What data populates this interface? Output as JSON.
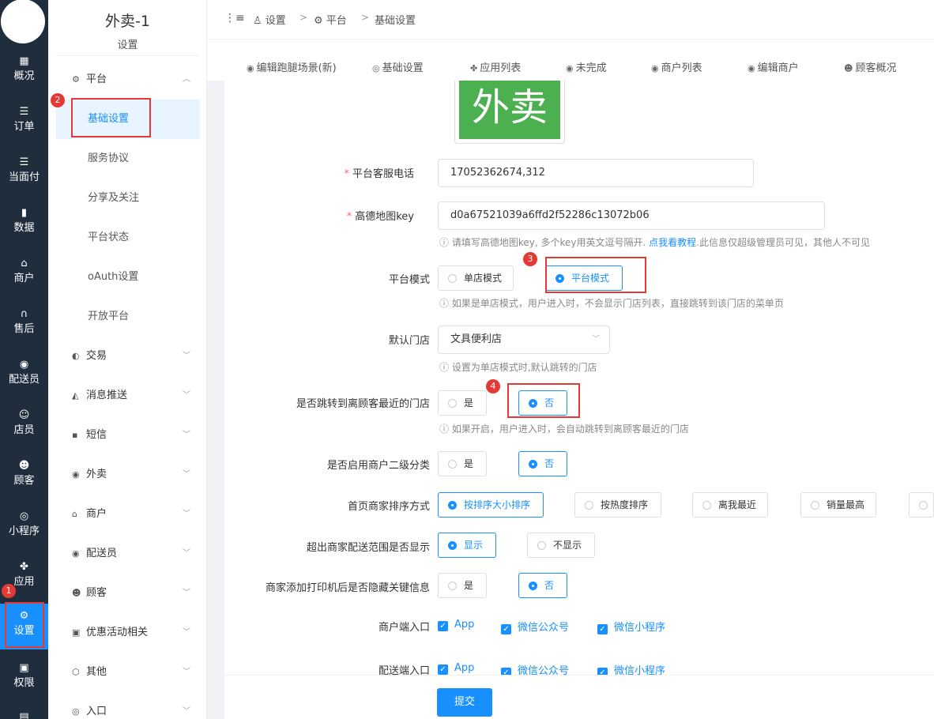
{
  "leftnav": {
    "items": [
      {
        "label": "概况",
        "icon": "grid-icon"
      },
      {
        "label": "订单",
        "icon": "list-icon"
      },
      {
        "label": "当面付",
        "icon": "list-icon"
      },
      {
        "label": "数据",
        "icon": "bar-chart-icon"
      },
      {
        "label": "商户",
        "icon": "store-icon"
      },
      {
        "label": "售后",
        "icon": "headset-icon"
      },
      {
        "label": "配送员",
        "icon": "scooter-icon"
      },
      {
        "label": "店员",
        "icon": "users-icon"
      },
      {
        "label": "顾客",
        "icon": "user-circle-icon"
      },
      {
        "label": "小程序",
        "icon": "wechat-icon"
      },
      {
        "label": "应用",
        "icon": "apps-icon"
      },
      {
        "label": "设置",
        "icon": "user-settings-icon"
      },
      {
        "label": "权限",
        "icon": "lock-icon"
      }
    ]
  },
  "annotations": {
    "n1": "1",
    "n2": "2",
    "n3": "3",
    "n4": "4"
  },
  "subnav": {
    "title": "外卖-1",
    "subtitle": "设置",
    "platform_group": "平台",
    "platform_items": [
      "基础设置",
      "服务协议",
      "分享及关注",
      "平台状态",
      "oAuth设置",
      "开放平台"
    ],
    "groups": [
      "交易",
      "消息推送",
      "短信",
      "外卖",
      "商户",
      "配送员",
      "顾客",
      "优惠活动相关",
      "其他",
      "入口"
    ]
  },
  "breadcrumb": {
    "items": [
      "设置",
      "平台",
      "基础设置"
    ],
    "separator": ">"
  },
  "tabs": [
    "编辑跑腿场景(新)",
    "基础设置",
    "应用列表",
    "未完成",
    "商户列表",
    "编辑商户",
    "顾客概况"
  ],
  "logo": {
    "text": "外卖"
  },
  "form": {
    "phone": {
      "label": "平台客服电话",
      "value": "17052362674,312"
    },
    "amap": {
      "label": "高德地图key",
      "value": "d0a67521039a6ffd2f52286c13072b06",
      "hint_pre": "请填写高德地图key, 多个key用英文逗号隔开. ",
      "hint_link": "点我看教程",
      "hint_post": ".此信息仅超级管理员可见，其他人不可见"
    },
    "mode": {
      "label": "平台模式",
      "options": [
        "单店模式",
        "平台模式"
      ],
      "selected": "平台模式",
      "hint": "如果是单店模式，用户进入时，不会显示门店列表，直接跳转到该门店的菜单页"
    },
    "default_store": {
      "label": "默认门店",
      "value": "文具便利店",
      "hint": "设置为单店模式时,默认跳转的门店"
    },
    "nearest": {
      "label": "是否跳转到离顾客最近的门店",
      "options": [
        "是",
        "否"
      ],
      "selected": "否",
      "hint": "如果开启，用户进入时，会自动跳转到离顾客最近的门店"
    },
    "subcat": {
      "label": "是否启用商户二级分类",
      "options": [
        "是",
        "否"
      ],
      "selected": "否"
    },
    "sort": {
      "label": "首页商家排序方式",
      "options": [
        "按排序大小排序",
        "按热度排序",
        "离我最近",
        "销量最高"
      ],
      "selected": "按排序大小排序"
    },
    "out_range": {
      "label": "超出商家配送范围是否显示",
      "options": [
        "显示",
        "不显示"
      ],
      "selected": "显示"
    },
    "printer": {
      "label": "商家添加打印机后是否隐藏关键信息",
      "options": [
        "是",
        "否"
      ],
      "selected": "否"
    },
    "merchant_entry": {
      "label": "商户端入口",
      "options": [
        "App",
        "微信公众号",
        "微信小程序"
      ]
    },
    "rider_entry": {
      "label": "配送端入口",
      "options": [
        "App",
        "微信公众号",
        "微信小程序"
      ]
    },
    "submit": "提交"
  },
  "colors": {
    "primary": "#1890ff",
    "nav_bg": "#1f2d3d",
    "annotation": "#e53935",
    "logo_bg": "#4caf50"
  }
}
